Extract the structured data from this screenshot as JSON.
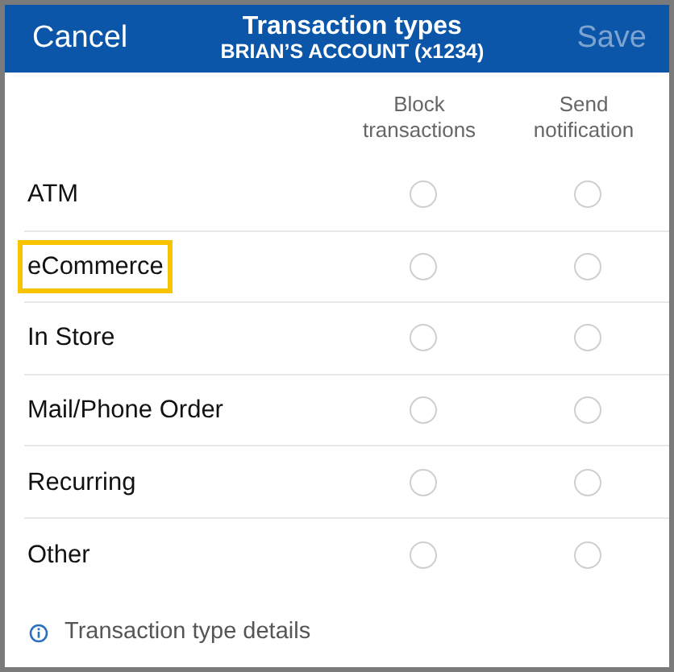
{
  "header": {
    "cancel": "Cancel",
    "title": "Transaction types",
    "subtitle": "BRIAN’S ACCOUNT (x1234)",
    "save": {
      "label": "Save",
      "disabled": true
    }
  },
  "columns": [
    "Block\ntransactions",
    "Send\nnotification"
  ],
  "rows": [
    {
      "label": "ATM",
      "highlighted": false,
      "block": false,
      "notify": false
    },
    {
      "label": "eCommerce",
      "highlighted": true,
      "block": false,
      "notify": false
    },
    {
      "label": "In Store",
      "highlighted": false,
      "block": false,
      "notify": false
    },
    {
      "label": "Mail/Phone Order",
      "highlighted": false,
      "block": false,
      "notify": false
    },
    {
      "label": "Recurring",
      "highlighted": false,
      "block": false,
      "notify": false
    },
    {
      "label": "Other",
      "highlighted": false,
      "block": false,
      "notify": false
    }
  ],
  "footer": {
    "link": "Transaction type details"
  }
}
